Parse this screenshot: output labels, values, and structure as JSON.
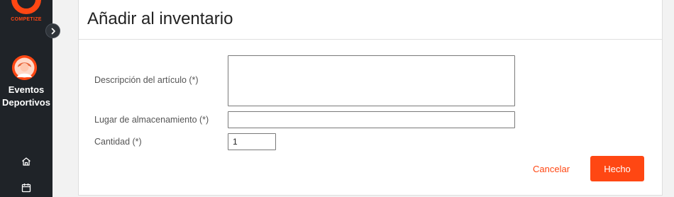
{
  "brand": {
    "logo_text": "COMPETIZE",
    "accent_color": "#ff4713"
  },
  "sidebar": {
    "org_name": "Eventos Deportivos",
    "nav": [
      {
        "icon": "home-icon"
      },
      {
        "icon": "calendar-icon"
      }
    ]
  },
  "dialog": {
    "title": "Añadir al inventario",
    "fields": {
      "description": {
        "label": "Descripción del artículo (*)",
        "value": ""
      },
      "location": {
        "label": "Lugar de almacenamiento (*)",
        "value": ""
      },
      "quantity": {
        "label": "Cantidad (*)",
        "value": "1"
      }
    },
    "cancel_label": "Cancelar",
    "done_label": "Hecho"
  }
}
